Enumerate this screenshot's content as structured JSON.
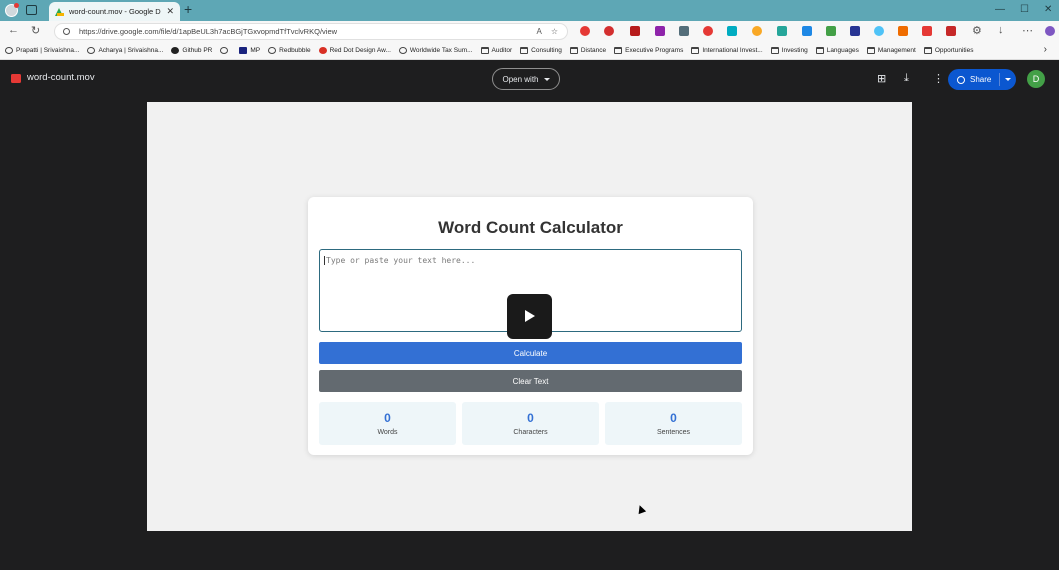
{
  "browser": {
    "tab_title": "word-count.mov - Google Drive",
    "tab_close": "✕",
    "new_tab": "+",
    "url": "https://drive.google.com/file/d/1apBeUL3h7acBGjTGxvopmdTfTvclvRKQ/view",
    "window_controls": [
      "—",
      "☐",
      "✕"
    ]
  },
  "bookmarks": [
    {
      "label": "Prapatti | Srivaishna...",
      "icon": "avatar"
    },
    {
      "label": "Acharya | Srivaishna...",
      "icon": "globe"
    },
    {
      "label": "Github PR",
      "icon": "github"
    },
    {
      "label": "",
      "icon": "globe"
    },
    {
      "label": "MP",
      "icon": "m"
    },
    {
      "label": "Redbubble",
      "icon": "globe"
    },
    {
      "label": "Red Dot Design Aw...",
      "icon": "red"
    },
    {
      "label": "Worldwide Tax Sum...",
      "icon": "globe"
    },
    {
      "label": "Auditor",
      "icon": "folder"
    },
    {
      "label": "Consulting",
      "icon": "folder"
    },
    {
      "label": "Distance",
      "icon": "folder"
    },
    {
      "label": "Executive Programs",
      "icon": "folder"
    },
    {
      "label": "International Invest...",
      "icon": "folder"
    },
    {
      "label": "Investing",
      "icon": "folder"
    },
    {
      "label": "Languages",
      "icon": "folder"
    },
    {
      "label": "Management",
      "icon": "folder"
    },
    {
      "label": "Opportunities",
      "icon": "folder"
    }
  ],
  "drive": {
    "file_name": "word-count.mov",
    "open_with": "Open with",
    "share": "Share",
    "user_initial": "D"
  },
  "app": {
    "title": "Word Count Calculator",
    "textarea_placeholder": "Type or paste your text here...",
    "calculate_label": "Calculate",
    "clear_label": "Clear Text",
    "stats": [
      {
        "value": "0",
        "label": "Words"
      },
      {
        "value": "0",
        "label": "Characters"
      },
      {
        "value": "0",
        "label": "Sentences"
      }
    ]
  },
  "colors": {
    "accent": "#3370d4",
    "clear_button": "#636a70",
    "share_button": "#0b57d0",
    "title_bar": "#5ea7b5"
  }
}
